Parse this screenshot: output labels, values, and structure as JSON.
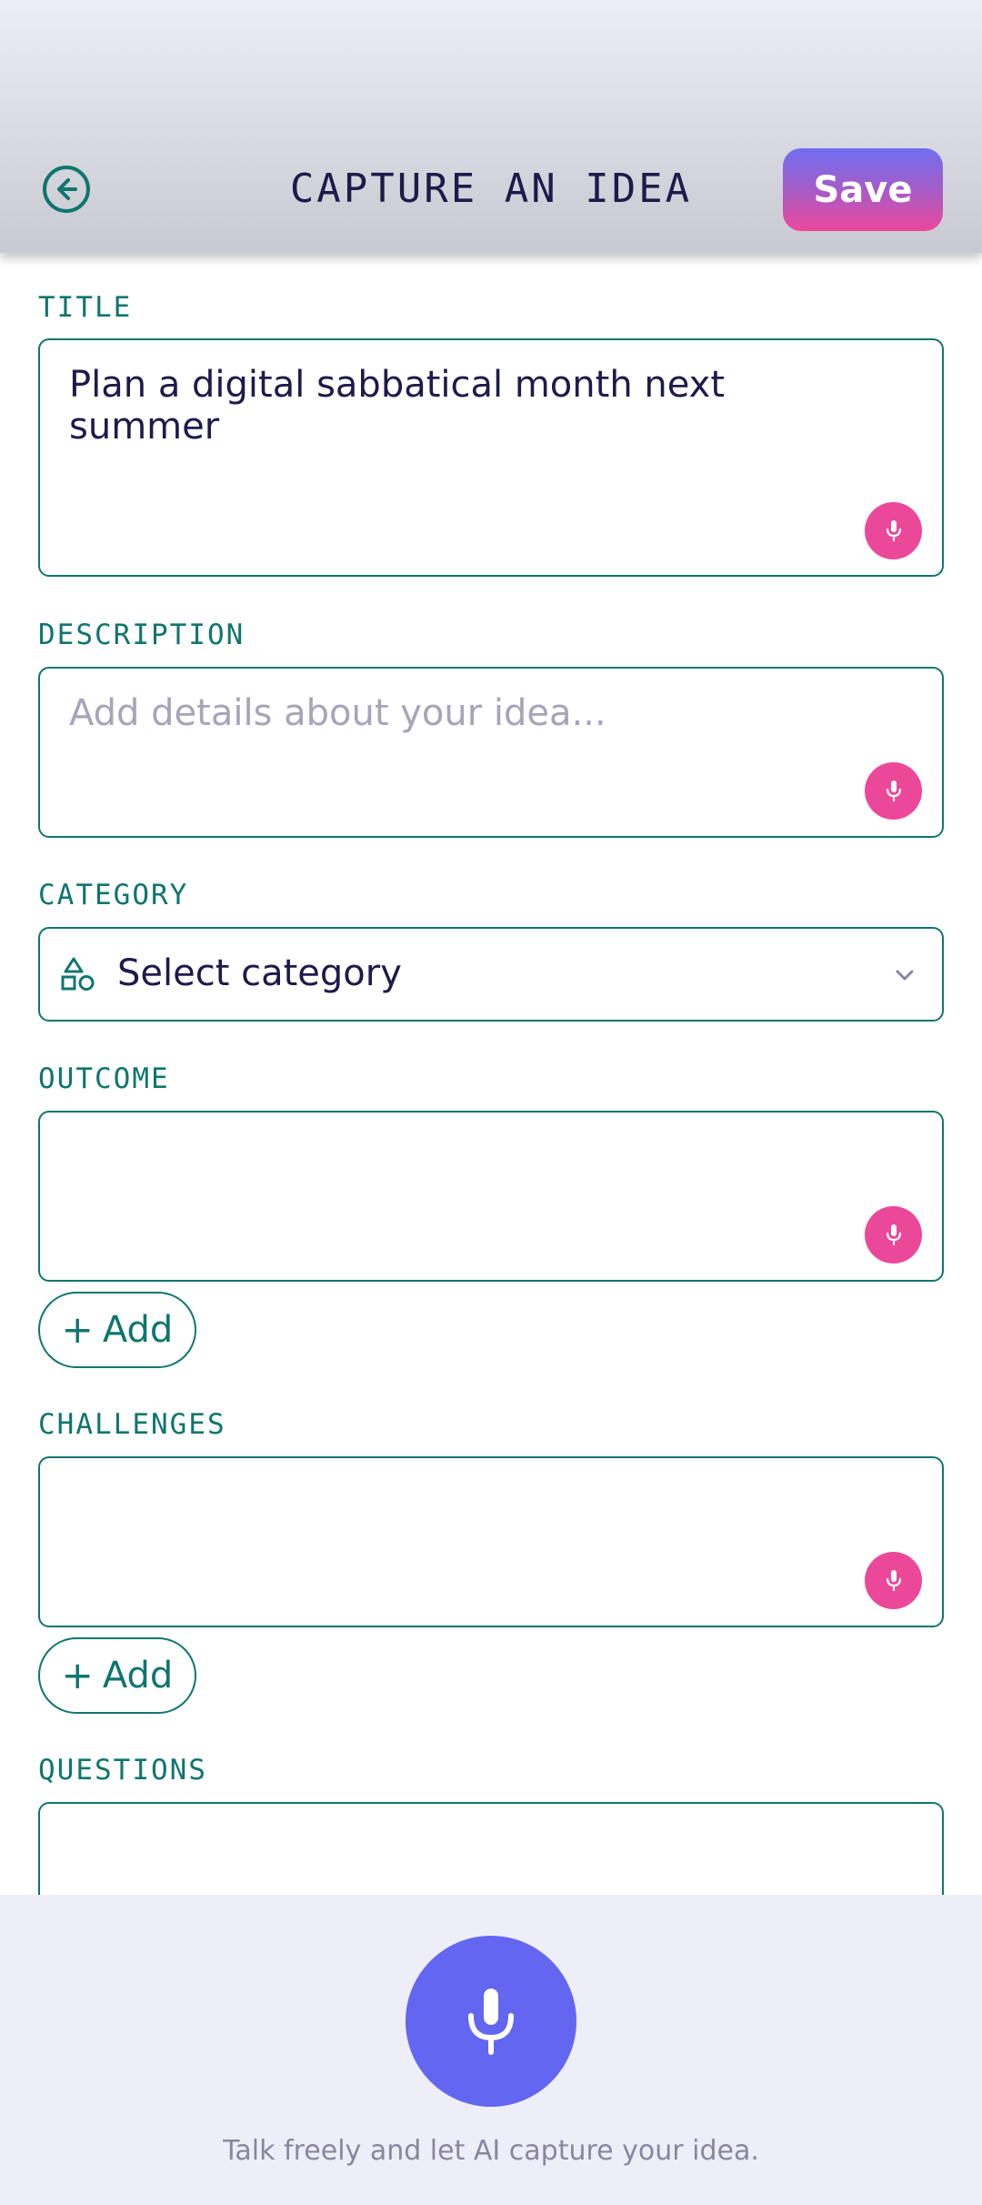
{
  "header": {
    "title": "CAPTURE AN IDEA",
    "save_label": "Save",
    "back_icon": "arrow-left-circle-icon"
  },
  "form": {
    "title": {
      "label": "TITLE",
      "value": "Plan a digital sabbatical month next summer",
      "placeholder": ""
    },
    "description": {
      "label": "DESCRIPTION",
      "value": "",
      "placeholder": "Add details about your idea..."
    },
    "category": {
      "label": "CATEGORY",
      "selected": "Select category",
      "icon": "shapes-icon"
    },
    "outcome": {
      "label": "OUTCOME",
      "value": "",
      "add_label": "Add"
    },
    "challenges": {
      "label": "CHALLENGES",
      "value": "",
      "add_label": "Add"
    },
    "questions": {
      "label": "QUESTIONS",
      "value": ""
    }
  },
  "voice": {
    "hint": "Talk freely and let AI capture your idea.",
    "icon": "microphone-icon"
  },
  "colors": {
    "accent_teal": "#0f766e",
    "mic_pink": "#ec4899",
    "mic_indigo": "#6366f1",
    "text_dark": "#1e1b4b"
  }
}
